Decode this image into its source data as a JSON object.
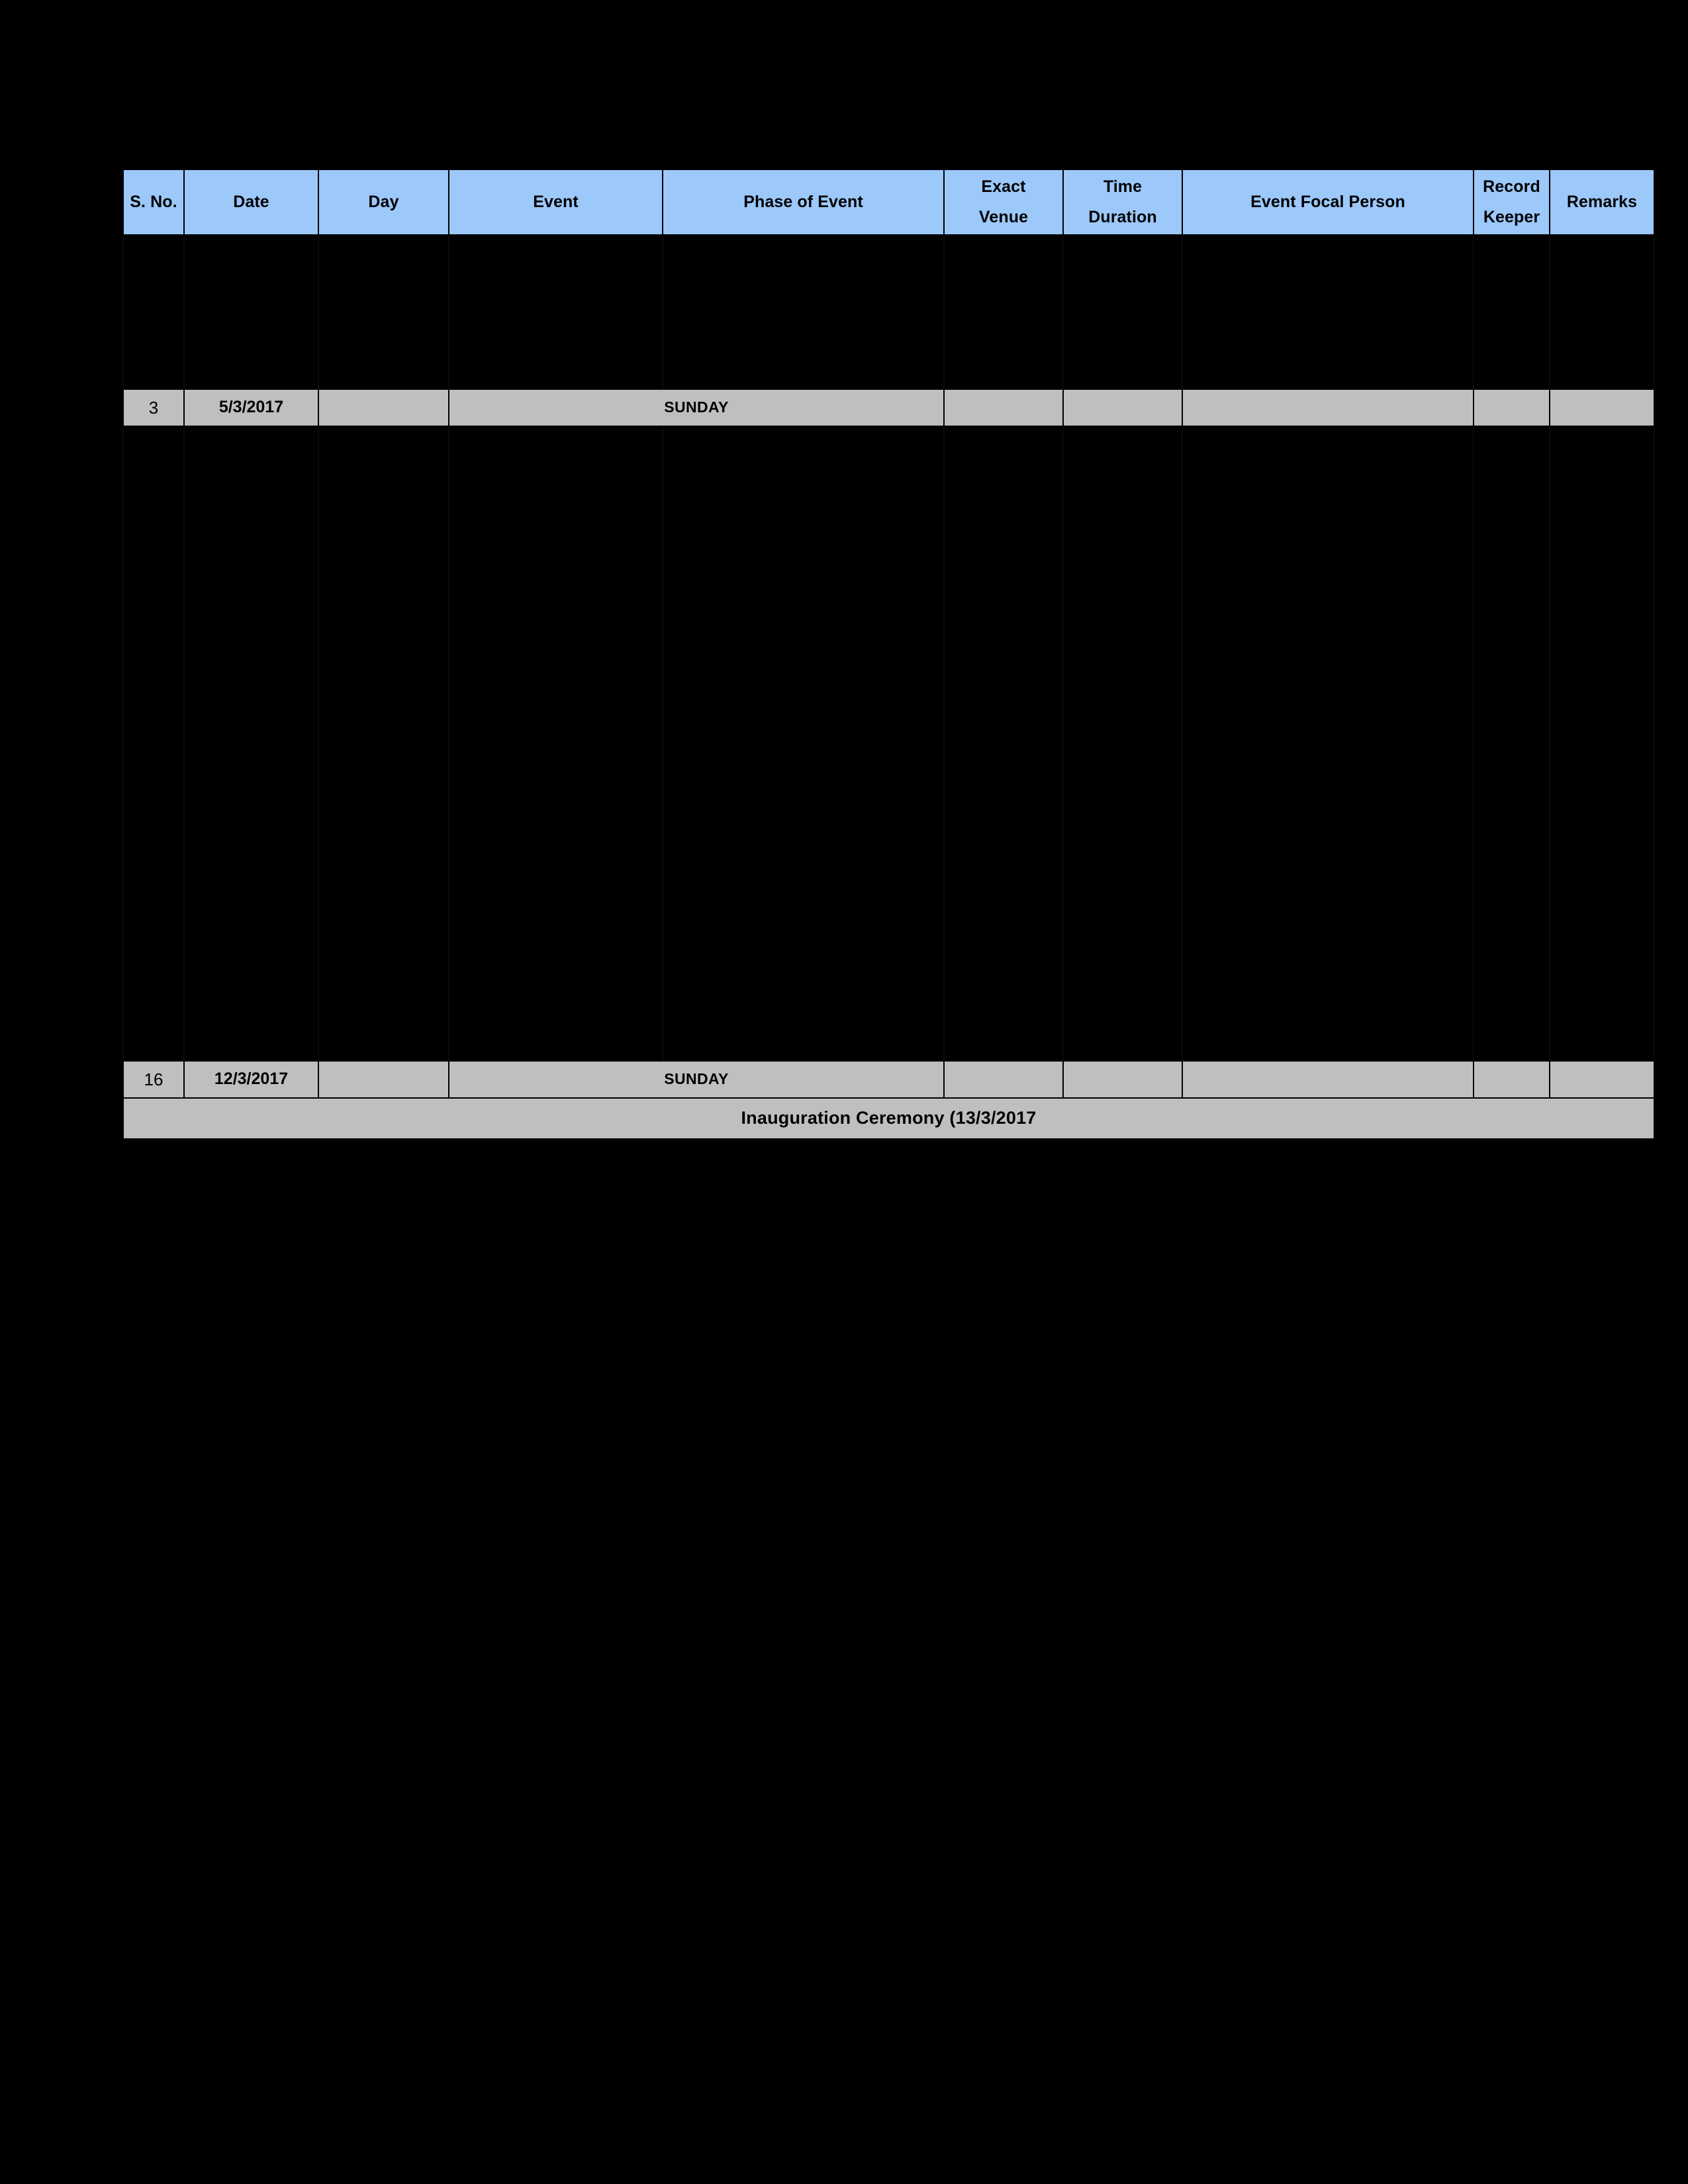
{
  "document": {
    "background_color": "#000000",
    "header_fill": "#9CC8FA",
    "row_fill": "#BFBFBF",
    "border_color": "#000000"
  },
  "table": {
    "name": "event-schedule-table",
    "columns": [
      {
        "key": "sno",
        "label": "S. No.",
        "lines": [
          "S. No."
        ]
      },
      {
        "key": "date",
        "label": "Date",
        "lines": [
          "Date"
        ]
      },
      {
        "key": "day",
        "label": "Day",
        "lines": [
          "Day"
        ]
      },
      {
        "key": "event",
        "label": "Event",
        "lines": [
          "Event"
        ]
      },
      {
        "key": "phase",
        "label": "Phase of Event",
        "lines": [
          "Phase of Event"
        ]
      },
      {
        "key": "venue",
        "label": "Exact Venue",
        "lines": [
          "Exact",
          "Venue"
        ]
      },
      {
        "key": "time",
        "label": "Time Duration",
        "lines": [
          "Time",
          "Duration"
        ]
      },
      {
        "key": "focal",
        "label": "Event Focal Person",
        "lines": [
          "Event Focal Person"
        ]
      },
      {
        "key": "record",
        "label": "Record Keeper",
        "lines": [
          "Record",
          "Keeper"
        ]
      },
      {
        "key": "remarks",
        "label": "Remarks",
        "lines": [
          "Remarks"
        ]
      }
    ],
    "rows": [
      {
        "type": "blank",
        "count": 7
      },
      {
        "type": "data",
        "sno": "3",
        "date": "5/3/2017",
        "day": "",
        "event_phase_merged": "SUNDAY",
        "venue": "",
        "time": "",
        "focal": "",
        "record": "",
        "remarks": ""
      },
      {
        "type": "blank",
        "count": 29
      },
      {
        "type": "data",
        "sno": "16",
        "date": "12/3/2017",
        "day": "",
        "event_phase_merged": "SUNDAY",
        "venue": "",
        "time": "",
        "focal": "",
        "record": "",
        "remarks": ""
      },
      {
        "type": "section",
        "title": "Inauguration Ceremony (13/3/2017"
      }
    ]
  },
  "header_cells": {
    "sno": "S. No.",
    "date": "Date",
    "day": "Day",
    "event": "Event",
    "phase": "Phase of Event",
    "venue_line1": "Exact",
    "venue_line2": "Venue",
    "time_line1": "Time",
    "time_line2": "Duration",
    "focal": "Event Focal Person",
    "record_line1": "Record",
    "record_line2": "Keeper",
    "remarks": "Remarks"
  },
  "row_3": {
    "sno": "3",
    "date": "5/3/2017",
    "sunday": "SUNDAY"
  },
  "row_16": {
    "sno": "16",
    "date": "12/3/2017",
    "sunday": "SUNDAY"
  },
  "section_inauguration": {
    "title": "Inauguration Ceremony (13/3/2017"
  }
}
